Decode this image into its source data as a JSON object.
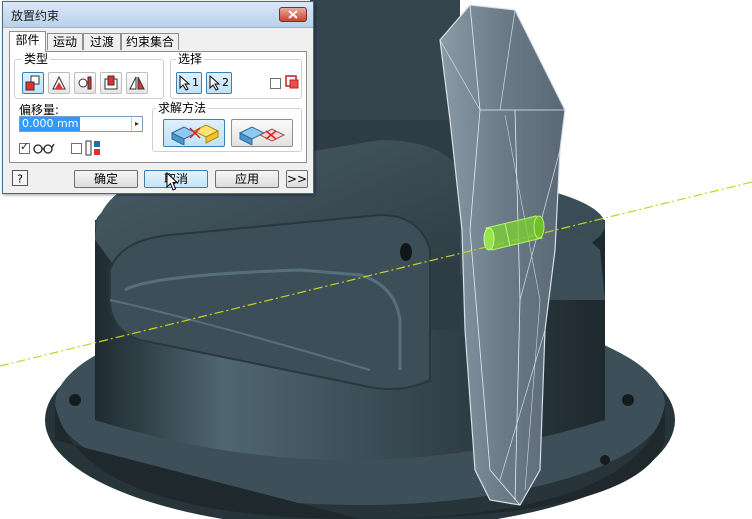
{
  "dialog": {
    "title": "放置约束",
    "tabs": [
      {
        "label": "部件",
        "active": true
      },
      {
        "label": "运动",
        "active": false
      },
      {
        "label": "过渡",
        "active": false
      },
      {
        "label": "约束集合",
        "active": false
      }
    ],
    "type_group_label": "类型",
    "type_icons": [
      "mate-constraint-icon",
      "angle-constraint-icon",
      "tangent-constraint-icon",
      "insert-constraint-icon",
      "symmetry-constraint-icon"
    ],
    "selection_group_label": "选择",
    "selection_1": "1",
    "selection_2": "2",
    "offset_label": "偏移量:",
    "offset_value": "0.000 mm",
    "solution_group_label": "求解方法",
    "buttons": {
      "ok": "确定",
      "cancel": "取消",
      "apply": "应用",
      "more": ">>"
    }
  },
  "colors": {
    "part_body": "#35444d",
    "axis_line": "#bfd21c",
    "highlight_green": "#8ed83c",
    "titlebar": "#c9dcf0"
  }
}
